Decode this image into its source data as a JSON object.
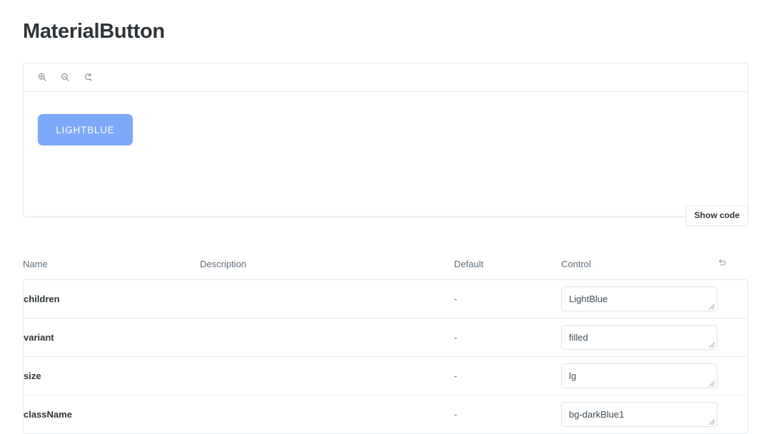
{
  "page": {
    "title": "MaterialButton"
  },
  "preview": {
    "toolbar": [
      {
        "icon": "zoom-in-icon",
        "label": "Zoom in"
      },
      {
        "icon": "zoom-out-icon",
        "label": "Zoom out"
      },
      {
        "icon": "zoom-reset-icon",
        "label": "Reset zoom"
      }
    ],
    "demo_button_label": "LIGHTBLUE",
    "demo_button_color": "#7ea8fa",
    "demo_button_text_color": "#ffffff",
    "show_code_label": "Show code"
  },
  "args_table": {
    "columns": [
      "Name",
      "Description",
      "Default",
      "Control"
    ],
    "reset_icon": "reset-controls-icon",
    "rows": [
      {
        "name": "children",
        "description": "",
        "default": "-",
        "control_value": "LightBlue",
        "control_type": "textarea"
      },
      {
        "name": "variant",
        "description": "",
        "default": "-",
        "control_value": "filled",
        "control_type": "textarea"
      },
      {
        "name": "size",
        "description": "",
        "default": "-",
        "control_value": "lg",
        "control_type": "textarea"
      },
      {
        "name": "className",
        "description": "",
        "default": "-",
        "control_value": "bg-darkBlue1",
        "control_type": "textarea"
      }
    ]
  }
}
